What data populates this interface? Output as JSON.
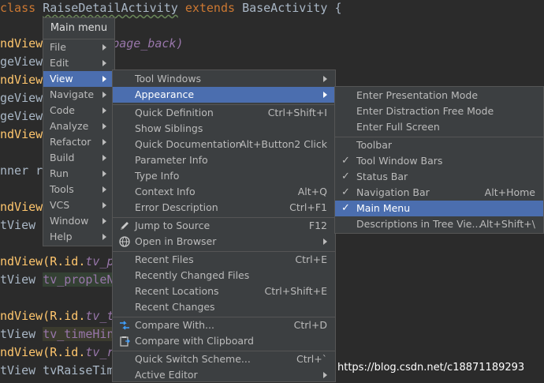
{
  "editor": {
    "line_class_decl": {
      "kw1": "class",
      "cls": "RaiseDetailActivity",
      "kw2": "extends",
      "base": "BaseActivity",
      "brace": "{"
    },
    "lines": [
      {
        "a": "ndView",
        "b": "page_back)"
      },
      {
        "a": "geView"
      },
      {
        "a": "ndView"
      },
      {
        "a": "geView"
      },
      {
        "a": "geView"
      },
      {
        "a": "ndView"
      },
      {
        "a": "nner r"
      },
      {
        "a": "ndView"
      },
      {
        "a": "tView t"
      },
      {
        "a": "ndView(R.id.",
        "b": "tv_p"
      },
      {
        "a": "tView ",
        "b": "tv_propleN"
      },
      {
        "a": "ndView(R.id.",
        "b": "tv_t"
      },
      {
        "a": "tView ",
        "b": "tv_timeHin"
      },
      {
        "a": "ndView(R.id.",
        "b": "tv_r"
      },
      {
        "a": "tView tvRaiseTim"
      }
    ]
  },
  "main_menu": {
    "title": "Main menu",
    "items": [
      {
        "label": "File"
      },
      {
        "label": "Edit"
      },
      {
        "label": "View"
      },
      {
        "label": "Navigate"
      },
      {
        "label": "Code"
      },
      {
        "label": "Analyze"
      },
      {
        "label": "Refactor"
      },
      {
        "label": "Build"
      },
      {
        "label": "Run"
      },
      {
        "label": "Tools"
      },
      {
        "label": "VCS"
      },
      {
        "label": "Window"
      },
      {
        "label": "Help"
      }
    ]
  },
  "view_menu": {
    "items": [
      {
        "label": "Tool Windows",
        "shortcut": ""
      },
      {
        "label": "Appearance",
        "shortcut": ""
      },
      {
        "label": "Quick Definition",
        "shortcut": "Ctrl+Shift+I"
      },
      {
        "label": "Show Siblings",
        "shortcut": ""
      },
      {
        "label": "Quick Documentation",
        "shortcut": "Alt+Button2 Click"
      },
      {
        "label": "Parameter Info",
        "shortcut": ""
      },
      {
        "label": "Type Info",
        "shortcut": ""
      },
      {
        "label": "Context Info",
        "shortcut": "Alt+Q"
      },
      {
        "label": "Error Description",
        "shortcut": "Ctrl+F1"
      },
      {
        "label": "Jump to Source",
        "shortcut": "F12"
      },
      {
        "label": "Open in Browser",
        "shortcut": ""
      },
      {
        "label": "Recent Files",
        "shortcut": "Ctrl+E"
      },
      {
        "label": "Recently Changed Files",
        "shortcut": ""
      },
      {
        "label": "Recent Locations",
        "shortcut": "Ctrl+Shift+E"
      },
      {
        "label": "Recent Changes",
        "shortcut": ""
      },
      {
        "label": "Compare With...",
        "shortcut": "Ctrl+D"
      },
      {
        "label": "Compare with Clipboard",
        "shortcut": ""
      },
      {
        "label": "Quick Switch Scheme...",
        "shortcut": "Ctrl+`"
      },
      {
        "label": "Active Editor",
        "shortcut": ""
      }
    ]
  },
  "appearance_menu": {
    "items": [
      {
        "label": "Enter Presentation Mode",
        "shortcut": ""
      },
      {
        "label": "Enter Distraction Free Mode",
        "shortcut": ""
      },
      {
        "label": "Enter Full Screen",
        "shortcut": ""
      },
      {
        "label": "Toolbar",
        "shortcut": ""
      },
      {
        "label": "Tool Window Bars",
        "shortcut": ""
      },
      {
        "label": "Status Bar",
        "shortcut": ""
      },
      {
        "label": "Navigation Bar",
        "shortcut": "Alt+Home"
      },
      {
        "label": "Main Menu",
        "shortcut": ""
      },
      {
        "label": "Descriptions in Tree Vie...",
        "shortcut": "Alt+Shift+\\"
      }
    ],
    "check_glyph": "✓"
  },
  "icons": {
    "jump_to_source": "pencil-icon",
    "open_in_browser": "globe-icon",
    "compare_with": "compare-arrows-icon",
    "compare_clipboard": "clipboard-icon"
  },
  "colors": {
    "menu_bg": "#3c3f41",
    "selection": "#4b6eaf",
    "editor_bg": "#2b2b2b",
    "keyword": "#cc7832",
    "method": "#ffc66d",
    "field": "#9876aa"
  },
  "watermark": "https://blog.csdn.net/c18871189293"
}
